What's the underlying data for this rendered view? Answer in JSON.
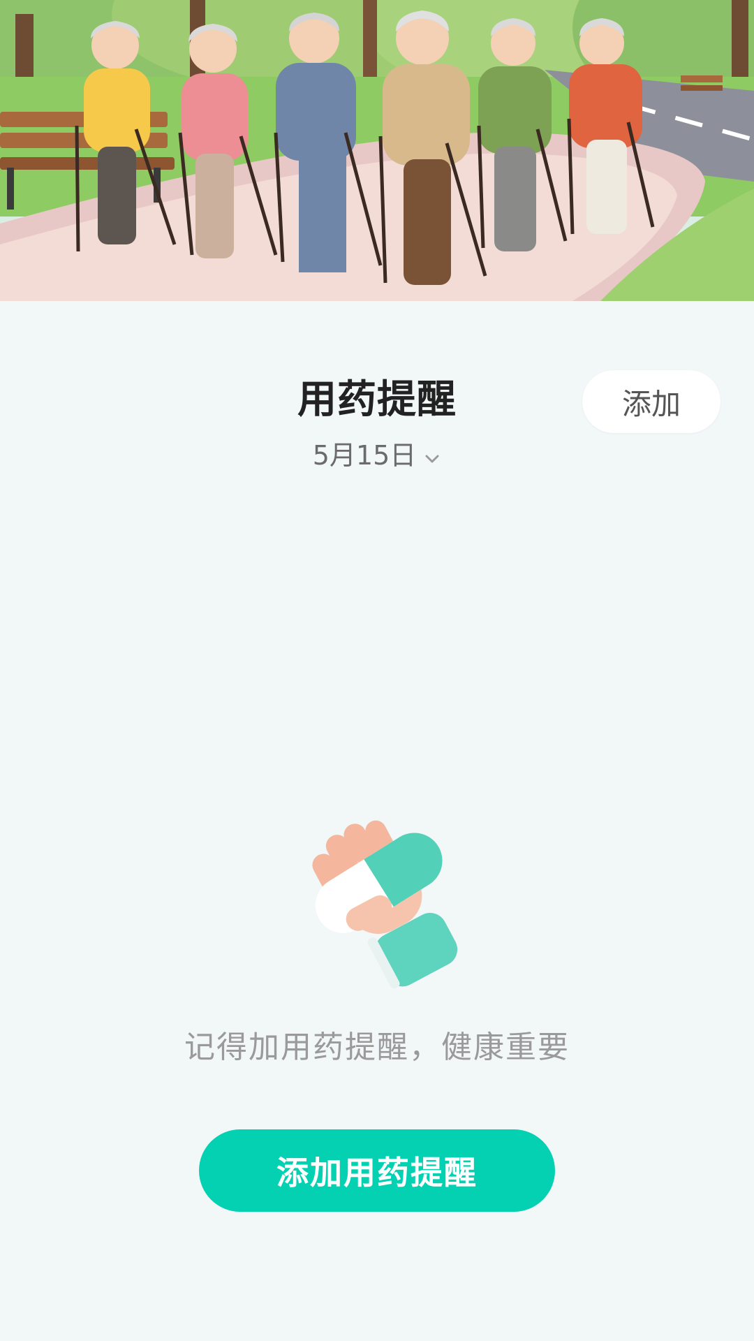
{
  "header": {
    "title": "用药提醒",
    "date": "5月15日",
    "add_label": "添加"
  },
  "empty_state": {
    "hint": "记得加用药提醒，健康重要",
    "button_label": "添加用药提醒"
  },
  "banner": {
    "image": "elderly-people-nordic-walking-in-park"
  },
  "icons": {
    "date_dropdown": "chevron-down-icon",
    "empty_state": "hand-holding-pill-icon"
  },
  "colors": {
    "accent": "#03d1b2",
    "background": "#f2f7f8",
    "title": "#222222",
    "hint": "#9a9a9a"
  }
}
